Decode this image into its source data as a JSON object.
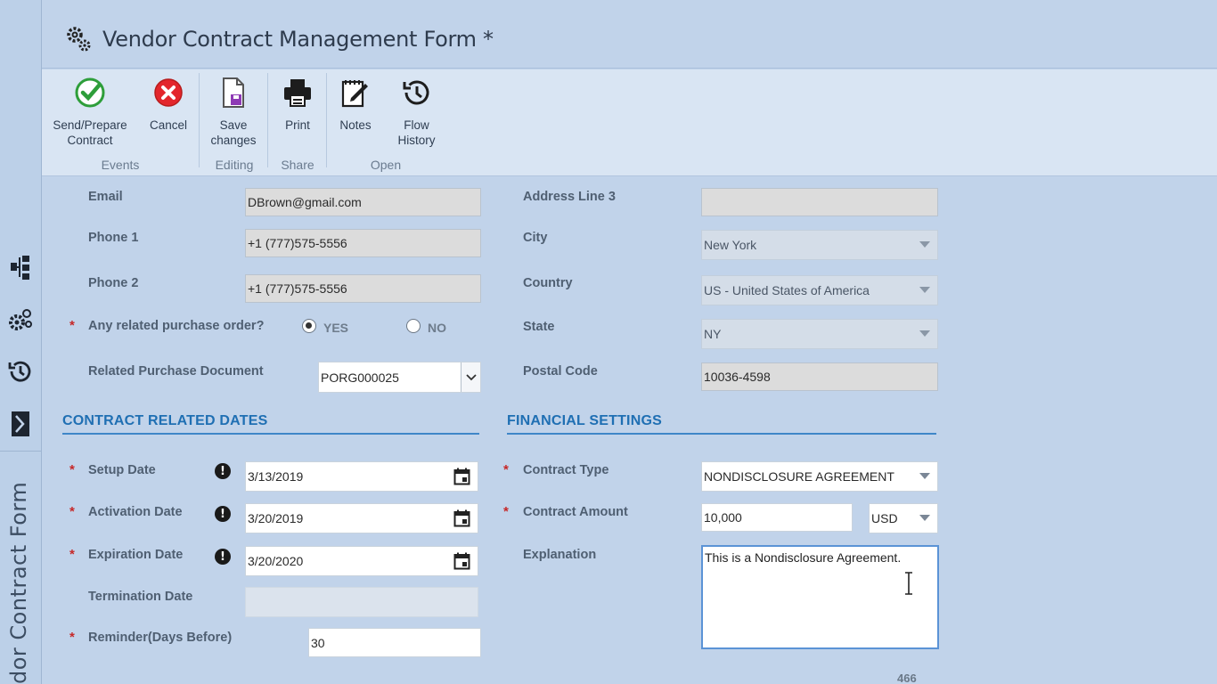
{
  "window": {
    "title": "Vendor Contract Management Form *"
  },
  "rail": {
    "vertical_title": "dor Contract Form"
  },
  "ribbon": {
    "buttons": [
      {
        "label": "Send/Prepare\nContract",
        "icon": "check-circle-icon"
      },
      {
        "label": "Cancel",
        "icon": "cancel-circle-icon"
      },
      {
        "label": "Save\nchanges",
        "icon": "save-document-icon"
      },
      {
        "label": "Print",
        "icon": "printer-icon"
      },
      {
        "label": "Notes",
        "icon": "notes-pencil-icon"
      },
      {
        "label": "Flow\nHistory",
        "icon": "history-clock-icon"
      }
    ],
    "groups": [
      "Events",
      "Editing",
      "Share",
      "Open"
    ]
  },
  "contact": {
    "email_label": "Email",
    "email_value": "DBrown@gmail.com",
    "phone1_label": "Phone 1",
    "phone1_value": "+1 (777)575-5556",
    "phone2_label": "Phone 2",
    "phone2_value": "+1 (777)575-5556",
    "po_question": "Any related purchase order?",
    "po_yes": "YES",
    "po_no": "NO",
    "po_selected": "YES",
    "related_doc_label": "Related Purchase Document",
    "related_doc_value": "PORG000025"
  },
  "address": {
    "line3_label": "Address Line 3",
    "line3_value": "",
    "city_label": "City",
    "city_value": "New York",
    "country_label": "Country",
    "country_value": "US - United States of America",
    "state_label": "State",
    "state_value": "NY",
    "postal_label": "Postal Code",
    "postal_value": "10036-4598"
  },
  "dates": {
    "section_title": "CONTRACT RELATED DATES",
    "setup_label": "Setup Date",
    "setup_value": "3/13/2019",
    "activation_label": "Activation Date",
    "activation_value": "3/20/2019",
    "expiration_label": "Expiration Date",
    "expiration_value": "3/20/2020",
    "termination_label": "Termination Date",
    "termination_value": "",
    "reminder_label": "Reminder(Days Before)",
    "reminder_value": "30"
  },
  "financial": {
    "section_title": "FINANCIAL SETTINGS",
    "type_label": "Contract Type",
    "type_value": "NONDISCLOSURE AGREEMENT",
    "amount_label": "Contract Amount",
    "amount_value": "10,000",
    "currency_value": "USD",
    "explanation_label": "Explanation",
    "explanation_value": "This is a Nondisclosure Agreement.",
    "char_counter": "466"
  },
  "colors": {
    "accent": "#1f6fb3",
    "required": "#c62828",
    "background": "#c1d3ea",
    "ribbon": "#d9e5f3"
  }
}
